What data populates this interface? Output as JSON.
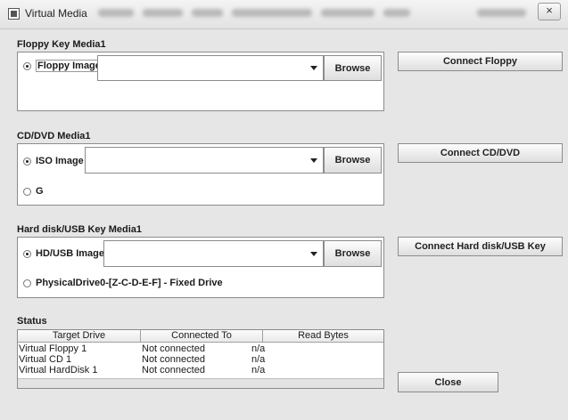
{
  "window": {
    "title": "Virtual Media",
    "close_glyph": "×"
  },
  "floppy": {
    "title": "Floppy Key Media1",
    "option_image": "Floppy Image",
    "image_value": "",
    "browse": "Browse",
    "connect": "Connect Floppy"
  },
  "cddvd": {
    "title": "CD/DVD Media1",
    "option_image": "ISO Image",
    "option_drive": "G",
    "image_value": "",
    "browse": "Browse",
    "connect": "Connect CD/DVD"
  },
  "hdd": {
    "title": "Hard disk/USB Key Media1",
    "option_image": "HD/USB Image",
    "option_drive": "PhysicalDrive0-[Z-C-D-E-F] - Fixed Drive",
    "image_value": "",
    "browse": "Browse",
    "connect": "Connect Hard disk/USB Key"
  },
  "status": {
    "title": "Status",
    "columns": [
      "Target Drive",
      "Connected To",
      "Read Bytes"
    ],
    "rows": [
      [
        "Virtual Floppy 1",
        "Not connected",
        "n/a"
      ],
      [
        "Virtual CD 1",
        "Not connected",
        "n/a"
      ],
      [
        "Virtual HardDisk 1",
        "Not connected",
        "n/a"
      ]
    ]
  },
  "close_button": "Close",
  "icons": {
    "window": "virtual-media-icon",
    "close": "close-icon",
    "dropdown": "chevron-down-icon"
  }
}
